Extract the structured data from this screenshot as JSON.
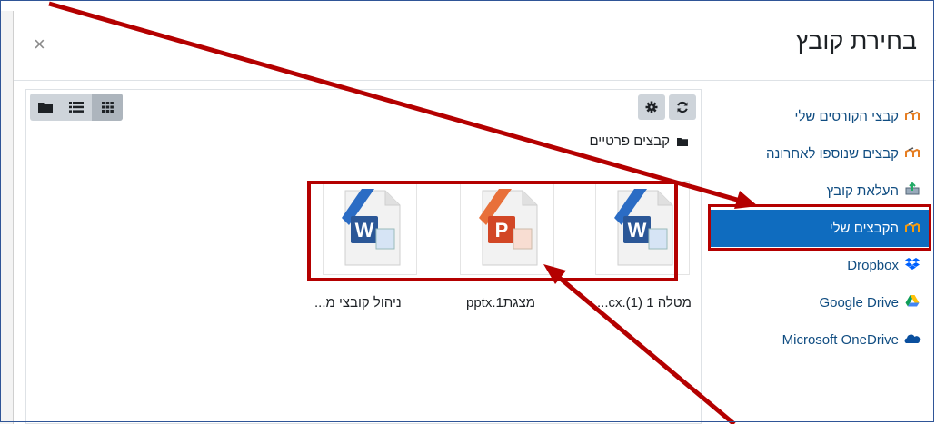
{
  "dialog": {
    "title": "בחירת קובץ",
    "close_label": "×"
  },
  "sidebar": {
    "items": [
      {
        "label": "קבצי הקורסים שלי",
        "icon": "moodle-icon"
      },
      {
        "label": "קבצים שנוספו לאחרונה",
        "icon": "moodle-icon"
      },
      {
        "label": "העלאת קובץ",
        "icon": "upload-icon"
      },
      {
        "label": "הקבצים שלי",
        "icon": "moodle-icon",
        "active": true
      },
      {
        "label": "Dropbox",
        "icon": "dropbox-icon"
      },
      {
        "label": "Google Drive",
        "icon": "google-drive-icon"
      },
      {
        "label": "Microsoft OneDrive",
        "icon": "onedrive-icon"
      }
    ]
  },
  "toolbar": {
    "view_icons": [
      "folder-view-icon",
      "list-view-icon",
      "grid-view-icon"
    ],
    "active_view": "grid-view-icon",
    "actions": [
      "settings-icon",
      "refresh-icon"
    ]
  },
  "path": {
    "label": "קבצים פרטיים"
  },
  "files": [
    {
      "label": "מטלה 1 (1).cx...",
      "type": "word"
    },
    {
      "label": "מצגת1.pptx",
      "type": "powerpoint"
    },
    {
      "label": "ניהול קובצי מ...",
      "type": "word"
    }
  ],
  "colors": {
    "active_bg": "#0f6cbf",
    "link": "#0f4c81",
    "annotation_red": "#b40000",
    "frame_border": "#2f5597"
  }
}
